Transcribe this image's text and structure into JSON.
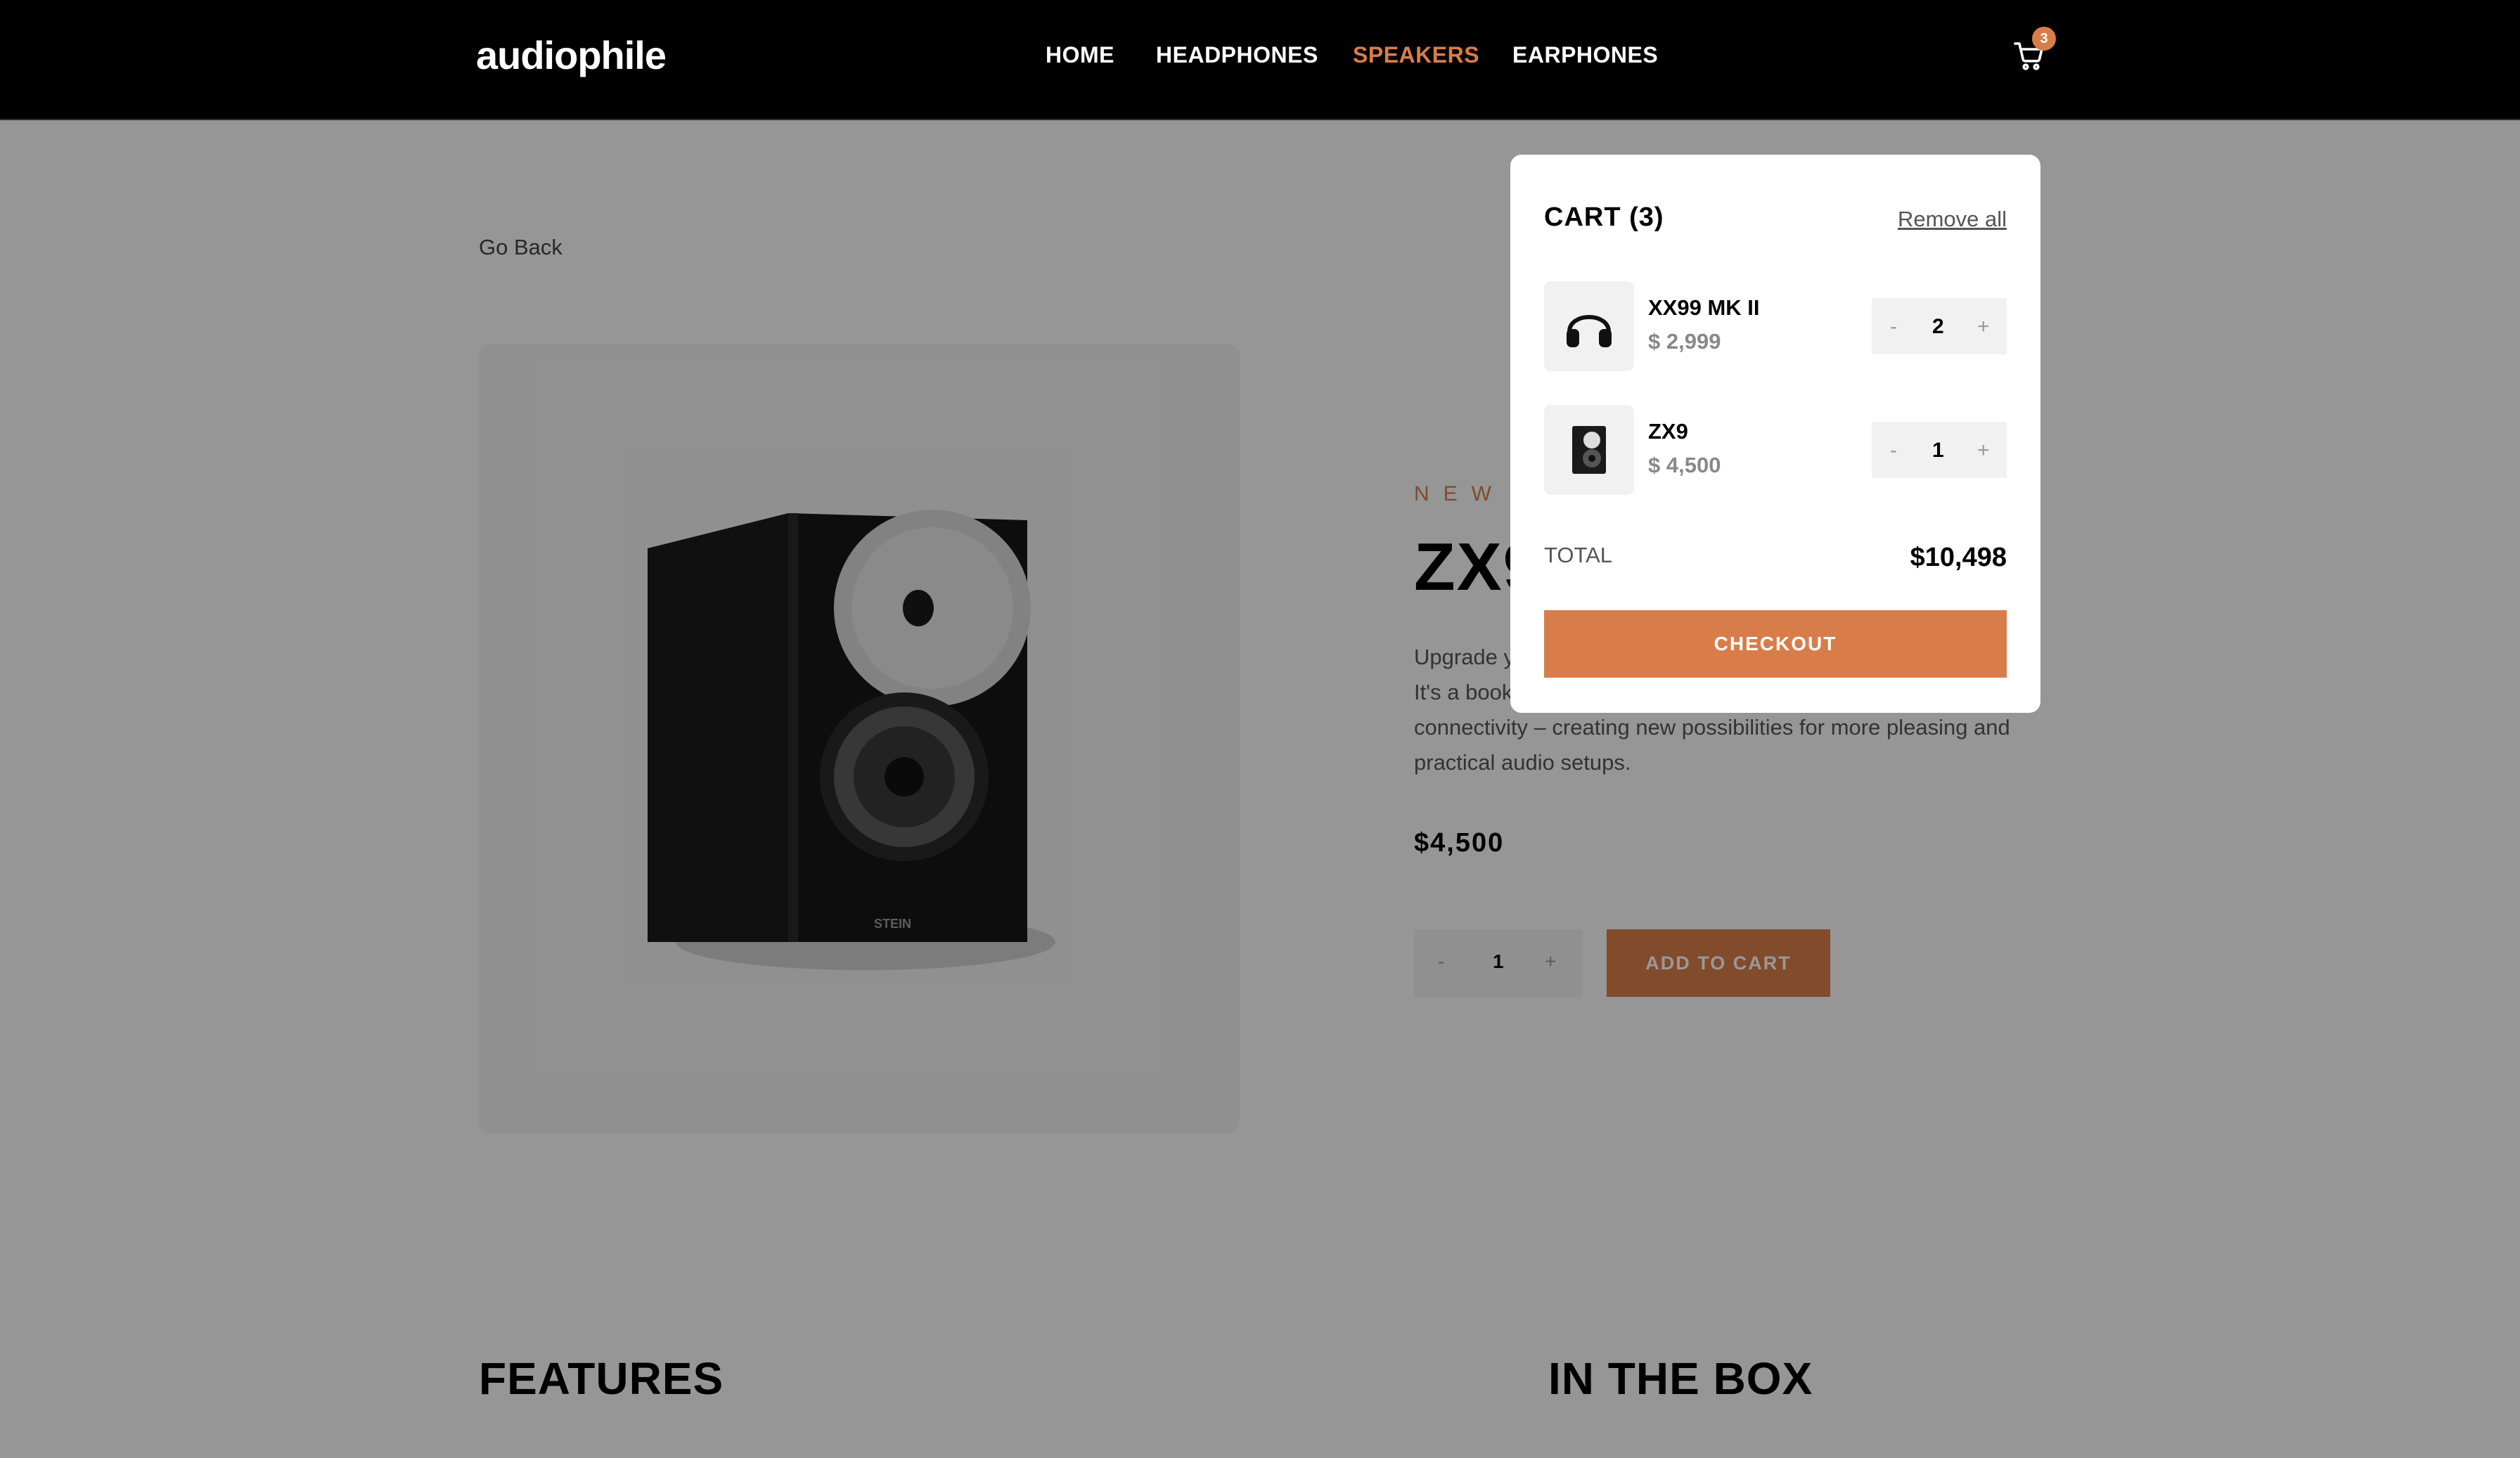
{
  "header": {
    "logo": "audiophile",
    "nav": [
      {
        "label": "HOME",
        "active": false
      },
      {
        "label": "HEADPHONES",
        "active": false
      },
      {
        "label": "SPEAKERS",
        "active": true
      },
      {
        "label": "EARPHONES",
        "active": false
      }
    ],
    "cart_count": "3",
    "cart_icon": "cart-icon"
  },
  "page": {
    "go_back": "Go Back",
    "new_label": "NEW",
    "title": "ZX9",
    "description_lines": [
      "Upgrade y",
      "It's a book",
      "connectivity – creating new possibilities for more pleasing and",
      "practical audio setups."
    ],
    "price": "$4,500",
    "quantity": "1",
    "minus": "-",
    "plus": "+",
    "add_to_cart": "ADD TO CART",
    "features_heading": "FEATURES",
    "in_the_box_heading": "IN THE BOX"
  },
  "cart": {
    "title": "CART (3)",
    "remove_all": "Remove all",
    "items": [
      {
        "name": "XX99 MK II",
        "price": "$ 2,999",
        "quantity": "2",
        "icon": "headphones-icon"
      },
      {
        "name": "ZX9",
        "price": "$ 4,500",
        "quantity": "1",
        "icon": "speaker-icon"
      }
    ],
    "minus": "-",
    "plus": "+",
    "total_label": "TOTAL",
    "total_value": "$10,498",
    "checkout": "CHECKOUT"
  },
  "colors": {
    "accent": "#d87d4a",
    "header_bg": "#000000"
  }
}
